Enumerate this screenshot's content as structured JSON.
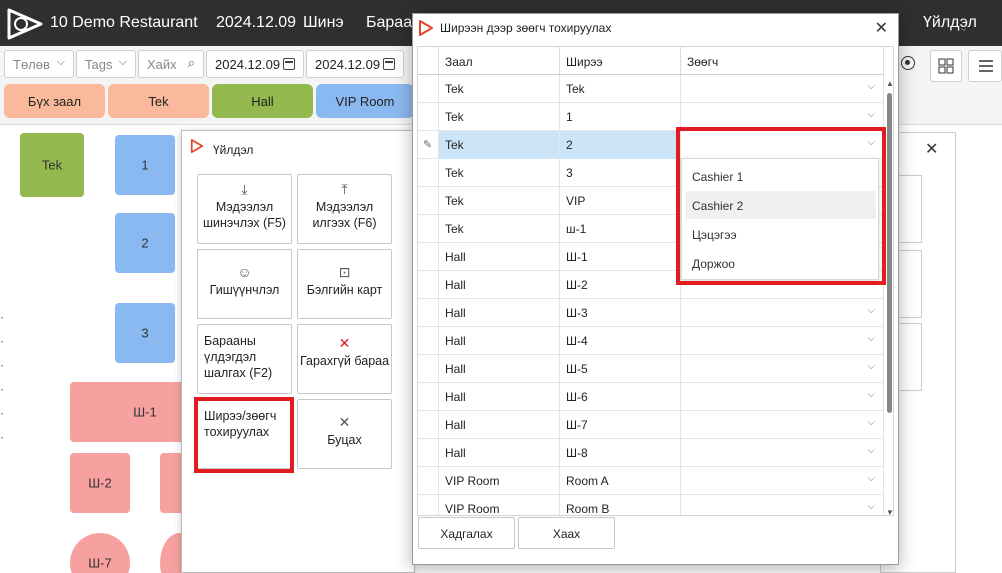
{
  "topbar": {
    "brand": "10 Demo Restaurant",
    "date": "2024.12.09",
    "new_label": "Шинэ",
    "goods_label": "Бараа",
    "actions_label": "Үйлдэл"
  },
  "filters": {
    "payment_placeholder": "Төлөв",
    "tags_placeholder": "Tags",
    "search_placeholder": "Хайх",
    "date_from": "2024.12.09",
    "date_to": "2024.12.09"
  },
  "halls": [
    {
      "label": "Бүх заал",
      "color": "#f9b99a"
    },
    {
      "label": "Tek",
      "color": "#f9b99a"
    },
    {
      "label": "Hall",
      "color": "#93b84e"
    },
    {
      "label": "VIP Room",
      "color": "#8ab8f0"
    }
  ],
  "floor_tables": [
    "Tek",
    "1",
    "2",
    "3",
    "Ш-1",
    "Ш-2",
    "Ш-7"
  ],
  "action_dialog": {
    "title": "Үйлдэл",
    "buttons": [
      "Мэдээлэл шинэчлэх (F5)",
      "Мэдээлэл илгээх (F6)",
      "Гишүүнчлэл",
      "Бэлгийн карт",
      "Барааны үлдэгдэл шалгах (F2)",
      "Гарахгүй бараа",
      "Ширээ/зөөгч тохируулах",
      "Буцах"
    ]
  },
  "modal": {
    "title": "Ширээн дээр зөөгч тохируулах",
    "columns": [
      "Заал",
      "Ширээ",
      "Зөөгч"
    ],
    "rows": [
      {
        "hall": "Tek",
        "table": "Tek",
        "waiter": ""
      },
      {
        "hall": "Tek",
        "table": "1",
        "waiter": ""
      },
      {
        "hall": "Tek",
        "table": "2",
        "waiter": ""
      },
      {
        "hall": "Tek",
        "table": "3",
        "waiter": ""
      },
      {
        "hall": "Tek",
        "table": "VIP",
        "waiter": ""
      },
      {
        "hall": "Tek",
        "table": "ш-1",
        "waiter": ""
      },
      {
        "hall": "Hall",
        "table": "Ш-1",
        "waiter": ""
      },
      {
        "hall": "Hall",
        "table": "Ш-2",
        "waiter": ""
      },
      {
        "hall": "Hall",
        "table": "Ш-3",
        "waiter": ""
      },
      {
        "hall": "Hall",
        "table": "Ш-4",
        "waiter": ""
      },
      {
        "hall": "Hall",
        "table": "Ш-5",
        "waiter": ""
      },
      {
        "hall": "Hall",
        "table": "Ш-6",
        "waiter": ""
      },
      {
        "hall": "Hall",
        "table": "Ш-7",
        "waiter": ""
      },
      {
        "hall": "Hall",
        "table": "Ш-8",
        "waiter": ""
      },
      {
        "hall": "VIP Room",
        "table": "Room A",
        "waiter": ""
      },
      {
        "hall": "VIP Room",
        "table": "Room B",
        "waiter": ""
      }
    ],
    "save_label": "Хадгалах",
    "close_label": "Хаах"
  },
  "dropdown": {
    "options": [
      "Cashier 1",
      "Cashier 2",
      "Цэцэгээ",
      "Доржоо"
    ],
    "hovered": "Cashier 2"
  },
  "colors": {
    "topbar": "#2f2f2f",
    "highlight": "#e31c24",
    "selected_row": "#cce4f7",
    "table_blue": "#8ab8f0",
    "table_green": "#93b84e",
    "table_pink": "#f7a0a0"
  }
}
